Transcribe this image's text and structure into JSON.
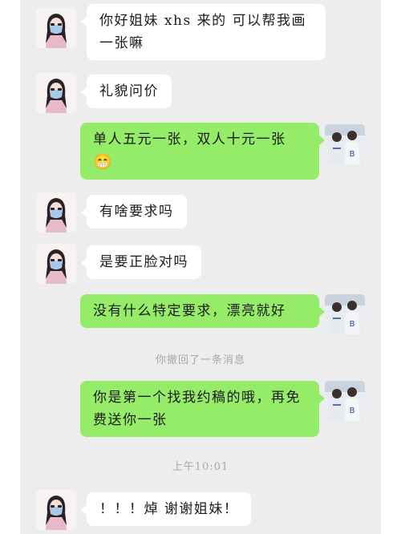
{
  "messages": [
    {
      "text": "你好姐妹 xhs 来的 可以帮我画一张嘛"
    },
    {
      "text": "礼貌问价"
    },
    {
      "text": "单人五元一张，双人十元一张",
      "emoji": "😁"
    },
    {
      "text": "有啥要求吗"
    },
    {
      "text": "是要正脸对吗"
    },
    {
      "text": "没有什么特定要求，漂亮就好"
    },
    {
      "text": "你是第一个找我约稿的哦，再免费送你一张"
    },
    {
      "text": "！！！焯 谢谢姐妹！"
    }
  ],
  "system": {
    "recall_notice": "你撤回了一条消息",
    "timestamp": "上午10:01"
  },
  "avatars": {
    "other": {
      "icon": "girl-with-mask-avatar"
    },
    "me": {
      "icon": "couple-jersey-avatar",
      "jersey_letter": "B"
    }
  },
  "colors": {
    "background": "#ededed",
    "incoming_bubble": "#ffffff",
    "outgoing_bubble": "#95ec69",
    "system_text": "#a7a7a7"
  }
}
